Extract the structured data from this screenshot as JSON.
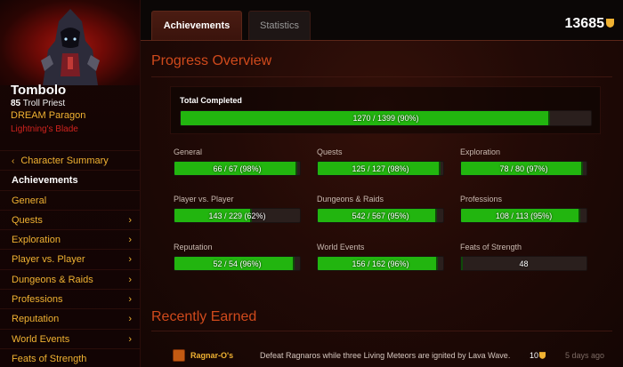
{
  "character": {
    "name": "Tombolo",
    "level": "85",
    "class_line": "Troll Priest",
    "guild": "DREAM Paragon",
    "realm": "Lightning's Blade"
  },
  "nav": {
    "back_label": "Character Summary",
    "items": [
      {
        "label": "Achievements",
        "active": true,
        "chevron": false
      },
      {
        "label": "General",
        "chevron": false
      },
      {
        "label": "Quests",
        "chevron": true
      },
      {
        "label": "Exploration",
        "chevron": true
      },
      {
        "label": "Player vs. Player",
        "chevron": true
      },
      {
        "label": "Dungeons & Raids",
        "chevron": true
      },
      {
        "label": "Professions",
        "chevron": true
      },
      {
        "label": "Reputation",
        "chevron": true
      },
      {
        "label": "World Events",
        "chevron": true
      },
      {
        "label": "Feats of Strength",
        "chevron": false
      }
    ]
  },
  "tabs": {
    "achievements": "Achievements",
    "statistics": "Statistics"
  },
  "points": "13685",
  "progress": {
    "title": "Progress Overview",
    "total": {
      "label": "Total Completed",
      "text": "1270 / 1399 (90%)",
      "fraction": 0.9
    },
    "categories": [
      {
        "label": "General",
        "text": "66 / 67 (98%)",
        "fraction": 0.98
      },
      {
        "label": "Quests",
        "text": "125 / 127 (98%)",
        "fraction": 0.98
      },
      {
        "label": "Exploration",
        "text": "78 / 80 (97%)",
        "fraction": 0.97
      },
      {
        "label": "Player vs. Player",
        "text": "143 / 229 (62%)",
        "fraction": 0.62
      },
      {
        "label": "Dungeons & Raids",
        "text": "542 / 567 (95%)",
        "fraction": 0.95
      },
      {
        "label": "Professions",
        "text": "108 / 113 (95%)",
        "fraction": 0.95
      },
      {
        "label": "Reputation",
        "text": "52 / 54 (96%)",
        "fraction": 0.96
      },
      {
        "label": "World Events",
        "text": "156 / 162 (96%)",
        "fraction": 0.96
      },
      {
        "label": "Feats of Strength",
        "text": "48",
        "fraction": 0.0
      }
    ]
  },
  "recent": {
    "title": "Recently Earned",
    "items": [
      {
        "name": "Ragnar-O's",
        "description": "Defeat Ragnaros while three Living Meteors are ignited by Lava Wave.",
        "points": "10",
        "time": "5 days ago"
      }
    ]
  },
  "colors": {
    "accent": "#f0b232",
    "bar_fill": "#22b50f",
    "heading": "#d04a1c",
    "realm": "#d0231e"
  }
}
